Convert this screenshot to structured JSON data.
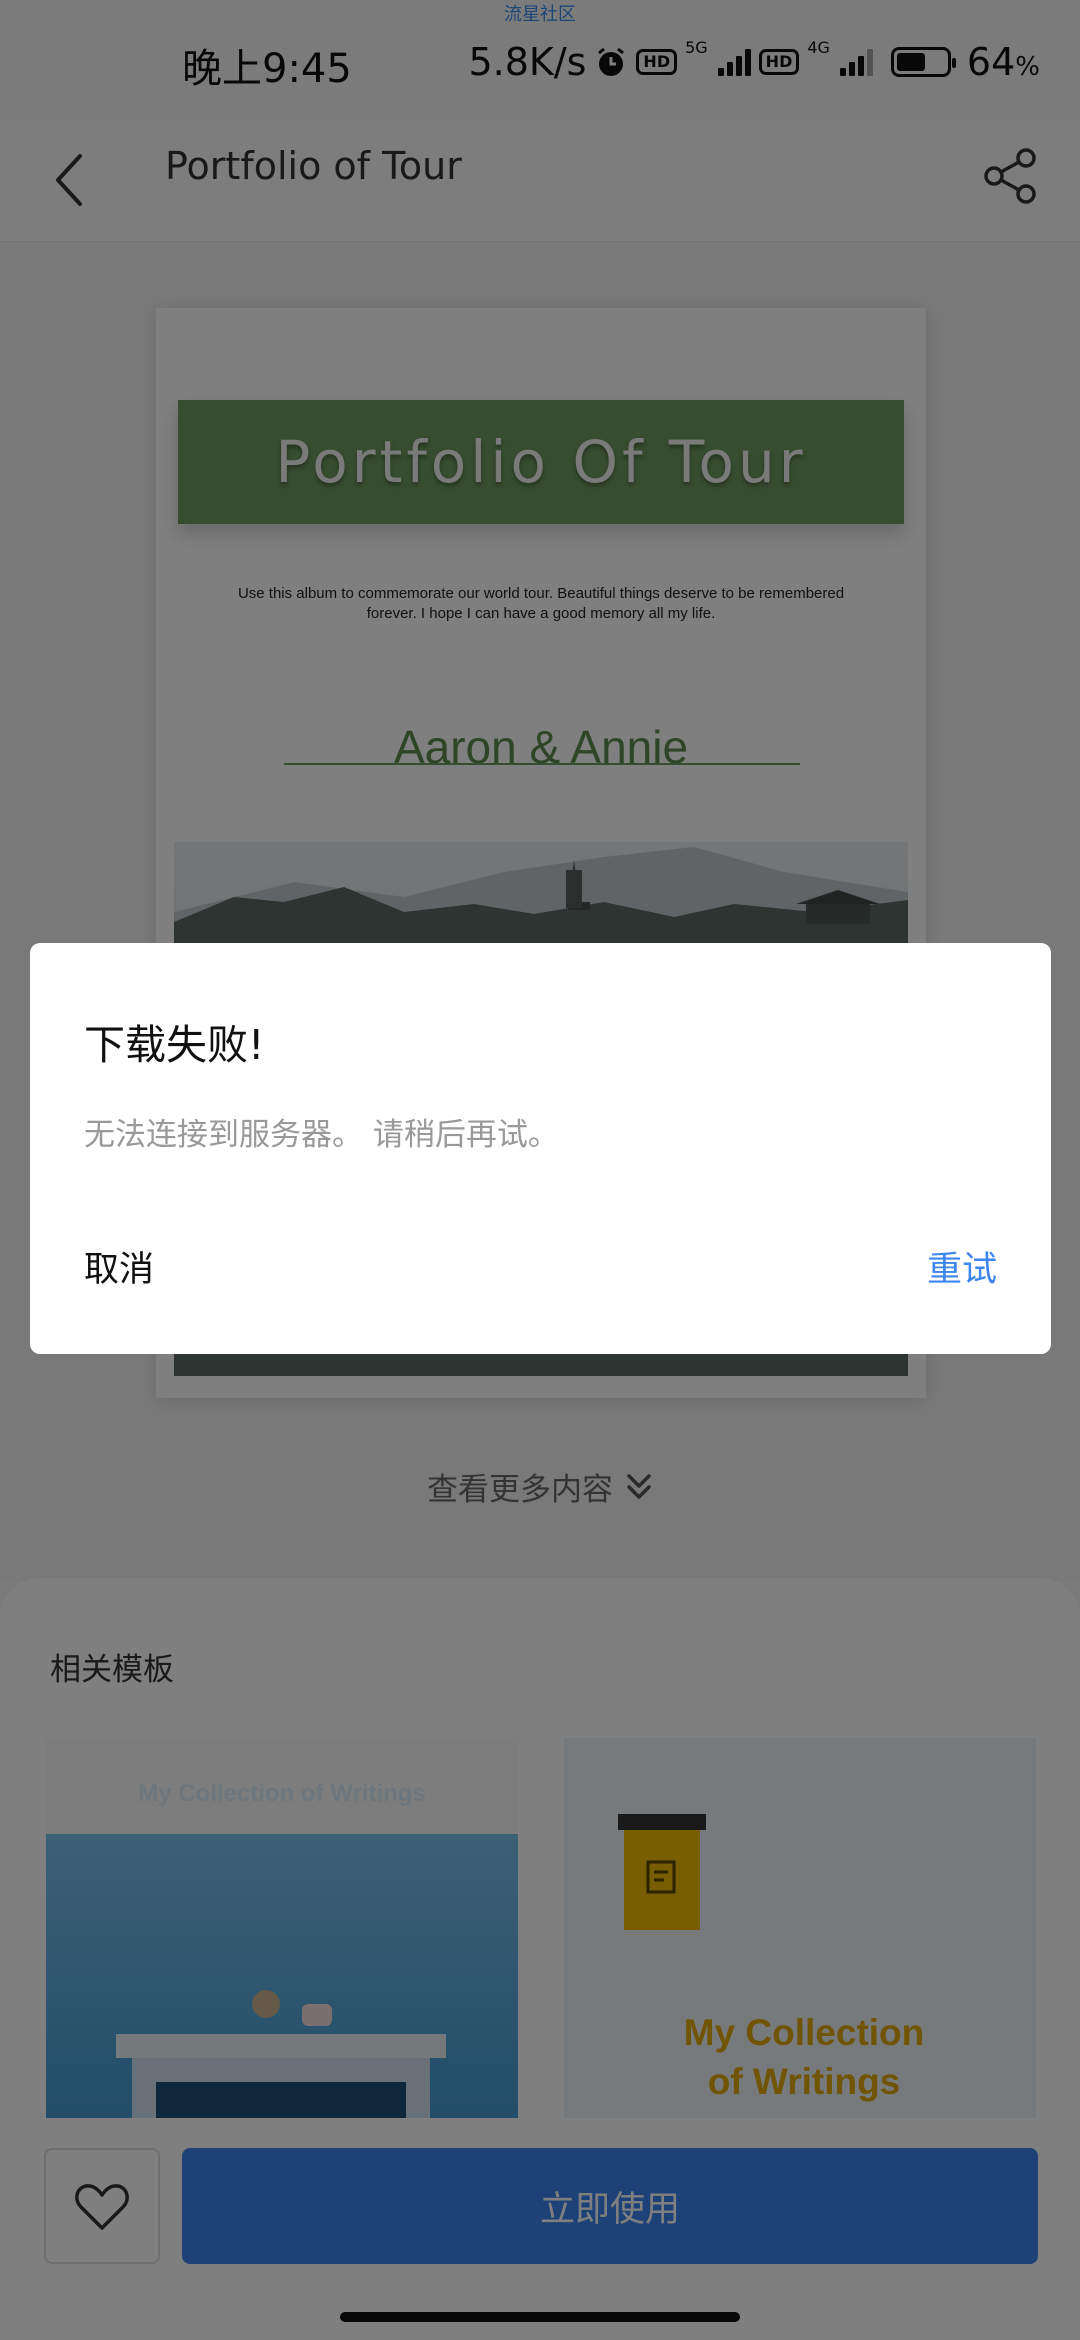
{
  "status_bar": {
    "caption": "流星社区",
    "time": "晚上9:45",
    "net_speed": "5.8K/s",
    "sim1_label": "5G",
    "sim2_label": "4G",
    "hd_label": "HD",
    "battery_percent": "64",
    "battery_unit": "%",
    "battery_level": 0.64
  },
  "nav": {
    "title": "Portfolio of Tour",
    "back_icon": "chevron-left-icon",
    "share_icon": "share-icon"
  },
  "poster": {
    "title": "Portfolio Of Tour",
    "description": "Use this album to commemorate our world tour. Beautiful things deserve to be remembered forever. I hope I can have a good memory all my life.",
    "names": "Aaron & Annie",
    "banner_color": "#6e9a5f"
  },
  "more_content": {
    "label": "查看更多内容",
    "icon": "double-chevron-down-icon"
  },
  "related": {
    "title": "相关模板",
    "templates": [
      {
        "text": "My Collection of Writings"
      },
      {
        "text_line1": "My Collection",
        "text_line2": "of Writings"
      }
    ]
  },
  "bottom_bar": {
    "favorite_icon": "heart-icon",
    "use_label": "立即使用",
    "accent": "#3d85f0"
  },
  "dialog": {
    "title": "下载失败!",
    "message": "无法连接到服务器。 请稍后再试。",
    "cancel_label": "取消",
    "retry_label": "重试",
    "retry_color": "#3d85f0"
  }
}
